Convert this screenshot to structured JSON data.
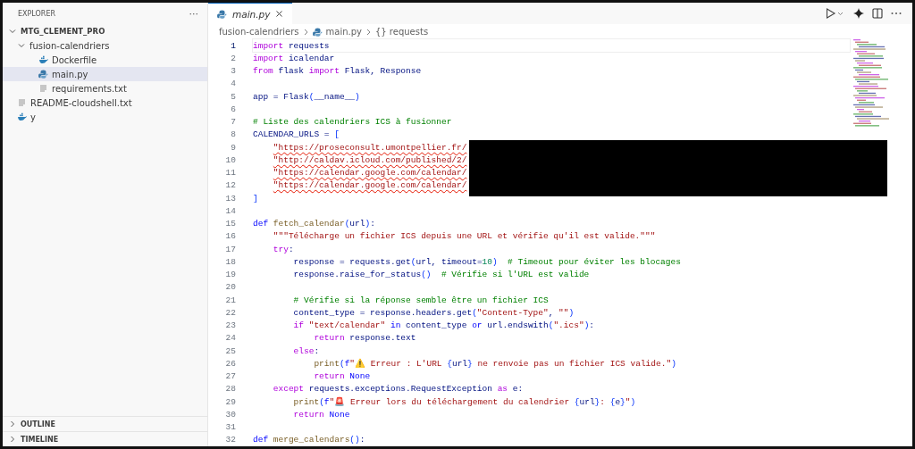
{
  "sidebar": {
    "title": "EXPLORER",
    "more": "···",
    "tree": [
      {
        "label": "MTG_CLEMENT_PRO",
        "kind": "root",
        "expanded": true,
        "selected": false,
        "children": [
          {
            "label": "fusion-calendriers",
            "kind": "folder",
            "expanded": true,
            "selected": false,
            "children": [
              {
                "label": "Dockerfile",
                "kind": "docker",
                "selected": false
              },
              {
                "label": "main.py",
                "kind": "python",
                "selected": true
              },
              {
                "label": "requirements.txt",
                "kind": "text",
                "selected": false
              }
            ]
          },
          {
            "label": "README-cloudshell.txt",
            "kind": "text",
            "selected": false
          },
          {
            "label": "y",
            "kind": "docker",
            "selected": false
          }
        ]
      }
    ],
    "panels": [
      {
        "label": "OUTLINE",
        "expanded": false
      },
      {
        "label": "TIMELINE",
        "expanded": false
      }
    ]
  },
  "tabs": [
    {
      "label": "main.py",
      "selected": true
    }
  ],
  "breadcrumb": [
    "fusion-calendriers",
    "main.py",
    "{} requests"
  ],
  "code": [
    {
      "n": "1",
      "current": true,
      "tokens": [
        {
          "kind": "kw",
          "text": "import"
        },
        {
          "kind": "plain",
          "text": " requests"
        }
      ]
    },
    {
      "n": "2",
      "current": false,
      "tokens": [
        {
          "kind": "kw",
          "text": "import"
        },
        {
          "kind": "plain",
          "text": " icalendar"
        }
      ]
    },
    {
      "n": "3",
      "current": false,
      "tokens": [
        {
          "kind": "kw",
          "text": "from"
        },
        {
          "kind": "plain",
          "text": " flask "
        },
        {
          "kind": "kw",
          "text": "import"
        },
        {
          "kind": "plain",
          "text": " Flask, Response"
        }
      ]
    },
    {
      "n": "4",
      "current": false
    },
    {
      "n": "5",
      "current": false,
      "tokens": [
        {
          "kind": "plain",
          "text": "app = Flask"
        },
        {
          "kind": "bracket",
          "text": "("
        },
        {
          "kind": "var",
          "text": "__name__"
        },
        {
          "kind": "bracket",
          "text": ")"
        }
      ]
    },
    {
      "n": "6",
      "current": false
    },
    {
      "n": "7",
      "current": false,
      "tokens": [
        {
          "kind": "comment",
          "text": "# Liste des calendriers ICS à fusionner"
        }
      ]
    },
    {
      "n": "8",
      "current": false,
      "tokens": [
        {
          "kind": "plain",
          "text": "CALENDAR_URLS = "
        },
        {
          "kind": "bracket",
          "text": "["
        }
      ]
    },
    {
      "n": "9",
      "current": false,
      "tokens": [
        {
          "kind": "string-error",
          "text": "    \"https://proseconsult.umontpellier.fr/"
        }
      ]
    },
    {
      "n": "10",
      "current": false,
      "tokens": [
        {
          "kind": "string-error",
          "text": "    \"http://caldav.icloud.com/published/2/"
        }
      ]
    },
    {
      "n": "11",
      "current": false,
      "tokens": [
        {
          "kind": "string-error",
          "text": "    \"https://calendar.google.com/calendar/"
        }
      ]
    },
    {
      "n": "12",
      "current": false,
      "tokens": [
        {
          "kind": "string-error",
          "text": "    \"https://calendar.google.com/calendar/"
        }
      ]
    },
    {
      "n": "13",
      "current": false,
      "tokens": [
        {
          "kind": "bracket",
          "text": "]"
        }
      ]
    },
    {
      "n": "14",
      "current": false
    },
    {
      "n": "15",
      "current": false,
      "tokens": [
        {
          "kind": "decl",
          "text": "def"
        },
        {
          "kind": "func",
          "text": " fetch_calendar"
        },
        {
          "kind": "bracket",
          "text": "("
        },
        {
          "kind": "var",
          "text": "url"
        },
        {
          "kind": "bracket",
          "text": ")"
        },
        {
          "kind": "plain",
          "text": ":"
        }
      ]
    },
    {
      "n": "16",
      "current": false,
      "tokens": [
        {
          "kind": "string",
          "text": "    \"\"\"Télécharge un fichier ICS depuis une URL et vérifie qu'il est valide.\"\"\""
        }
      ]
    },
    {
      "n": "17",
      "current": false,
      "tokens": [
        {
          "kind": "kw",
          "text": "    try"
        },
        {
          "kind": "plain",
          "text": ":"
        }
      ]
    },
    {
      "n": "18",
      "current": false,
      "tokens": [
        {
          "kind": "plain",
          "text": "        response = requests.get"
        },
        {
          "kind": "bracket",
          "text": "("
        },
        {
          "kind": "plain",
          "text": "url, "
        },
        {
          "kind": "var",
          "text": "timeout"
        },
        {
          "kind": "plain",
          "text": "="
        },
        {
          "kind": "number",
          "text": "10"
        },
        {
          "kind": "bracket",
          "text": ")"
        },
        {
          "kind": "comment",
          "text": "  # Timeout pour éviter les blocages"
        }
      ]
    },
    {
      "n": "19",
      "current": false,
      "tokens": [
        {
          "kind": "plain",
          "text": "        response.raise_for_status"
        },
        {
          "kind": "bracket",
          "text": "()"
        },
        {
          "kind": "comment",
          "text": "  # Vérifie si l'URL est valide"
        }
      ]
    },
    {
      "n": "20",
      "current": false
    },
    {
      "n": "21",
      "current": false,
      "tokens": [
        {
          "kind": "comment",
          "text": "        # Vérifie si la réponse semble être un fichier ICS"
        }
      ]
    },
    {
      "n": "22",
      "current": false,
      "tokens": [
        {
          "kind": "plain",
          "text": "        content_type = response.headers.get"
        },
        {
          "kind": "bracket",
          "text": "("
        },
        {
          "kind": "string",
          "text": "\"Content-Type\""
        },
        {
          "kind": "plain",
          "text": ", "
        },
        {
          "kind": "string",
          "text": "\"\""
        },
        {
          "kind": "bracket",
          "text": ")"
        }
      ]
    },
    {
      "n": "23",
      "current": false,
      "tokens": [
        {
          "kind": "kw",
          "text": "        if"
        },
        {
          "kind": "string",
          "text": " \"text/calendar\""
        },
        {
          "kind": "decl",
          "text": " in"
        },
        {
          "kind": "plain",
          "text": " content_type"
        },
        {
          "kind": "decl",
          "text": " or"
        },
        {
          "kind": "plain",
          "text": " url.endswith"
        },
        {
          "kind": "bracket",
          "text": "("
        },
        {
          "kind": "string",
          "text": "\".ics\""
        },
        {
          "kind": "bracket",
          "text": ")"
        },
        {
          "kind": "plain",
          "text": ":"
        }
      ]
    },
    {
      "n": "24",
      "current": false,
      "tokens": [
        {
          "kind": "kw",
          "text": "            return"
        },
        {
          "kind": "plain",
          "text": " response.text"
        }
      ]
    },
    {
      "n": "25",
      "current": false,
      "tokens": [
        {
          "kind": "kw",
          "text": "        else"
        },
        {
          "kind": "plain",
          "text": ":"
        }
      ]
    },
    {
      "n": "26",
      "current": false,
      "tokens": [
        {
          "kind": "func",
          "text": "            print"
        },
        {
          "kind": "bracket",
          "text": "("
        },
        {
          "kind": "decl",
          "text": "f"
        },
        {
          "kind": "string",
          "text": "\""
        },
        {
          "kind": "emoji",
          "text": "⚠️"
        },
        {
          "kind": "string",
          "text": " Erreur : L'URL "
        },
        {
          "kind": "bracket",
          "text": "{"
        },
        {
          "kind": "plain",
          "text": "url"
        },
        {
          "kind": "bracket",
          "text": "}"
        },
        {
          "kind": "string",
          "text": " ne renvoie pas un fichier ICS valide.\""
        },
        {
          "kind": "bracket",
          "text": ")"
        }
      ]
    },
    {
      "n": "27",
      "current": false,
      "tokens": [
        {
          "kind": "kw",
          "text": "            return"
        },
        {
          "kind": "decl",
          "text": " None"
        }
      ]
    },
    {
      "n": "28",
      "current": false,
      "tokens": [
        {
          "kind": "kw",
          "text": "    except"
        },
        {
          "kind": "plain",
          "text": " requests.exceptions.RequestException "
        },
        {
          "kind": "kw",
          "text": "as"
        },
        {
          "kind": "plain",
          "text": " e:"
        }
      ]
    },
    {
      "n": "29",
      "current": false,
      "tokens": [
        {
          "kind": "func",
          "text": "        print"
        },
        {
          "kind": "bracket",
          "text": "("
        },
        {
          "kind": "decl",
          "text": "f"
        },
        {
          "kind": "string",
          "text": "\""
        },
        {
          "kind": "emoji",
          "text": "🚨"
        },
        {
          "kind": "string",
          "text": " Erreur lors du téléchargement du calendrier "
        },
        {
          "kind": "bracket",
          "text": "{"
        },
        {
          "kind": "plain",
          "text": "url"
        },
        {
          "kind": "bracket",
          "text": "}"
        },
        {
          "kind": "string",
          "text": ": "
        },
        {
          "kind": "bracket",
          "text": "{"
        },
        {
          "kind": "plain",
          "text": "e"
        },
        {
          "kind": "bracket",
          "text": "}"
        },
        {
          "kind": "string",
          "text": "\""
        },
        {
          "kind": "bracket",
          "text": ")"
        }
      ]
    },
    {
      "n": "30",
      "current": false,
      "tokens": [
        {
          "kind": "kw",
          "text": "        return"
        },
        {
          "kind": "decl",
          "text": " None"
        }
      ]
    },
    {
      "n": "31",
      "current": false
    },
    {
      "n": "32",
      "current": false,
      "tokens": [
        {
          "kind": "decl",
          "text": "def"
        },
        {
          "kind": "func",
          "text": " merge_calendars"
        },
        {
          "kind": "bracket",
          "text": "()"
        },
        {
          "kind": "plain",
          "text": ":"
        }
      ]
    }
  ]
}
